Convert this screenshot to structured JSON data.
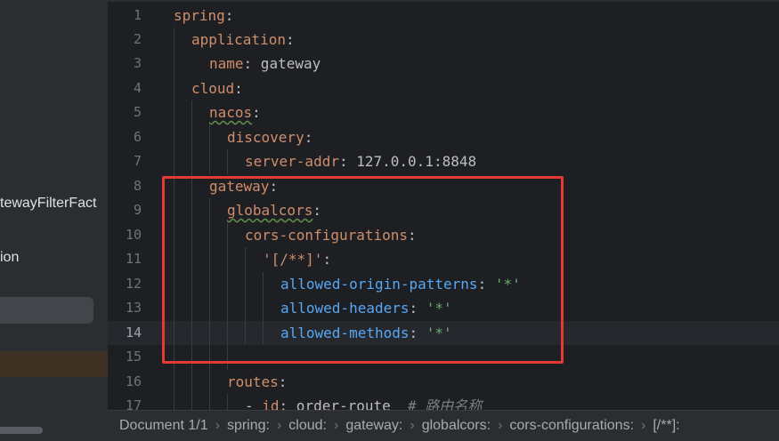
{
  "sidebar": {
    "items": [
      "tewayFilterFact",
      "ion"
    ]
  },
  "editor": {
    "lines": [
      {
        "num": "1",
        "key": "spring",
        "colon": ":"
      },
      {
        "num": "2",
        "key": "application",
        "colon": ":"
      },
      {
        "num": "3",
        "key": "name",
        "colon": ":",
        "value": " gateway"
      },
      {
        "num": "4",
        "key": "cloud",
        "colon": ":"
      },
      {
        "num": "5",
        "key": "nacos",
        "colon": ":"
      },
      {
        "num": "6",
        "key": "discovery",
        "colon": ":"
      },
      {
        "num": "7",
        "key": "server-addr",
        "colon": ":",
        "value": " 127.0.0.1:8848"
      },
      {
        "num": "8",
        "key": "gateway",
        "colon": ":"
      },
      {
        "num": "9",
        "key": "globalcors",
        "colon": ":"
      },
      {
        "num": "10",
        "key": "cors-configurations",
        "colon": ":"
      },
      {
        "num": "11",
        "key": "'[/**]'",
        "colon": ":"
      },
      {
        "num": "12",
        "key": "allowed-origin-patterns",
        "colon": ":",
        "value": " '*'"
      },
      {
        "num": "13",
        "key": "allowed-headers",
        "colon": ":",
        "value": " '*'"
      },
      {
        "num": "14",
        "key": "allowed-methods",
        "colon": ":",
        "value": " '*'"
      },
      {
        "num": "15"
      },
      {
        "num": "16",
        "key": "routes",
        "colon": ":"
      },
      {
        "num": "17",
        "dash": "- ",
        "key": "id",
        "colon": ":",
        "value": " order-route",
        "comment": "  # 路由名称"
      }
    ],
    "current_line": "14"
  },
  "breadcrumb": {
    "items": [
      "Document 1/1",
      "spring:",
      "cloud:",
      "gateway:",
      "globalcors:",
      "cors-configurations:",
      "[/**]:"
    ]
  },
  "colors": {
    "key": "#cf8e6d",
    "key_nested": "#56a8f5",
    "string": "#6aab73",
    "comment": "#7a7e85",
    "highlight_box": "#e53935"
  }
}
